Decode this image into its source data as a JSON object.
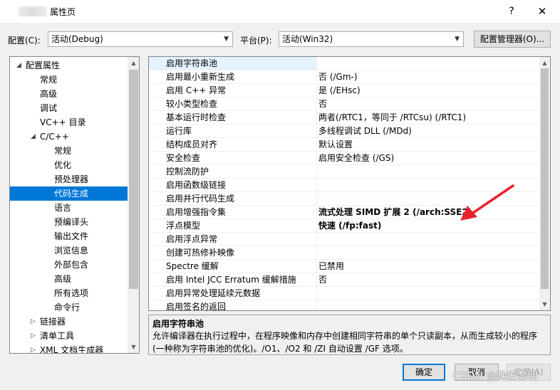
{
  "window": {
    "title": "属性页",
    "help": "?",
    "close": "✕"
  },
  "toolbar": {
    "config_label": "配置(C):",
    "config_value": "活动(Debug)",
    "platform_label": "平台(P):",
    "platform_value": "活动(Win32)",
    "config_manager_button": "配置管理器(O)..."
  },
  "tree": {
    "items": [
      {
        "label": "配置属性",
        "level": 0,
        "expander": "expanded"
      },
      {
        "label": "常规",
        "level": 1
      },
      {
        "label": "高级",
        "level": 1
      },
      {
        "label": "调试",
        "level": 1
      },
      {
        "label": "VC++ 目录",
        "level": 1
      },
      {
        "label": "C/C++",
        "level": 1,
        "expander": "expanded"
      },
      {
        "label": "常规",
        "level": 2
      },
      {
        "label": "优化",
        "level": 2
      },
      {
        "label": "预处理器",
        "level": 2
      },
      {
        "label": "代码生成",
        "level": 2,
        "selected": true
      },
      {
        "label": "语言",
        "level": 2
      },
      {
        "label": "预编译头",
        "level": 2
      },
      {
        "label": "输出文件",
        "level": 2
      },
      {
        "label": "浏览信息",
        "level": 2
      },
      {
        "label": "外部包含",
        "level": 2
      },
      {
        "label": "高级",
        "level": 2
      },
      {
        "label": "所有选项",
        "level": 2
      },
      {
        "label": "命令行",
        "level": 2
      },
      {
        "label": "链接器",
        "level": 1,
        "expander": "collapsed"
      },
      {
        "label": "清单工具",
        "level": 1,
        "expander": "collapsed"
      },
      {
        "label": "XML 文档生成器",
        "level": 1,
        "expander": "collapsed"
      }
    ]
  },
  "properties": [
    {
      "name": "启用字符串池",
      "value": "",
      "selected": true
    },
    {
      "name": "启用最小重新生成",
      "value": "否 (/Gm-)"
    },
    {
      "name": "启用 C++ 异常",
      "value": "是 (/EHsc)"
    },
    {
      "name": "较小类型检查",
      "value": "否"
    },
    {
      "name": "基本运行时检查",
      "value": "两者(/RTC1，等同于 /RTCsu) (/RTC1)"
    },
    {
      "name": "运行库",
      "value": "多线程调试 DLL (/MDd)"
    },
    {
      "name": "结构成员对齐",
      "value": "默认设置"
    },
    {
      "name": "安全检查",
      "value": "启用安全检查 (/GS)"
    },
    {
      "name": "控制流防护",
      "value": ""
    },
    {
      "name": "启用函数级链接",
      "value": ""
    },
    {
      "name": "启用并行代码生成",
      "value": ""
    },
    {
      "name": "启用增强指令集",
      "value": "流式处理 SIMD 扩展 2 (/arch:SSE2)",
      "bold": true
    },
    {
      "name": "浮点模型",
      "value": "快速 (/fp:fast)",
      "bold": true
    },
    {
      "name": "启用浮点异常",
      "value": ""
    },
    {
      "name": "创建可热修补映像",
      "value": ""
    },
    {
      "name": "Spectre 缓解",
      "value": "已禁用"
    },
    {
      "name": "启用 Intel JCC Erratum 缓解措施",
      "value": "否"
    },
    {
      "name": "启用异常处理延续元数据",
      "value": ""
    },
    {
      "name": "启用签名的返回",
      "value": ""
    }
  ],
  "description": {
    "title": "启用字符串池",
    "text": "允许编译器在执行过程中，在程序映像和内存中创建相同字符串的单个只读副本，从而生成较小的程序(一种称为字符串池的优化)。/O1、/O2 和 /ZI 自动设置 /GF 选项。"
  },
  "buttons": {
    "ok": "确定",
    "cancel": "取消",
    "apply": "应用(A)"
  },
  "watermark": "CSDN @晚安黎明",
  "colors": {
    "selection": "#0078d7",
    "annotation_arrow": "#e8232d"
  }
}
